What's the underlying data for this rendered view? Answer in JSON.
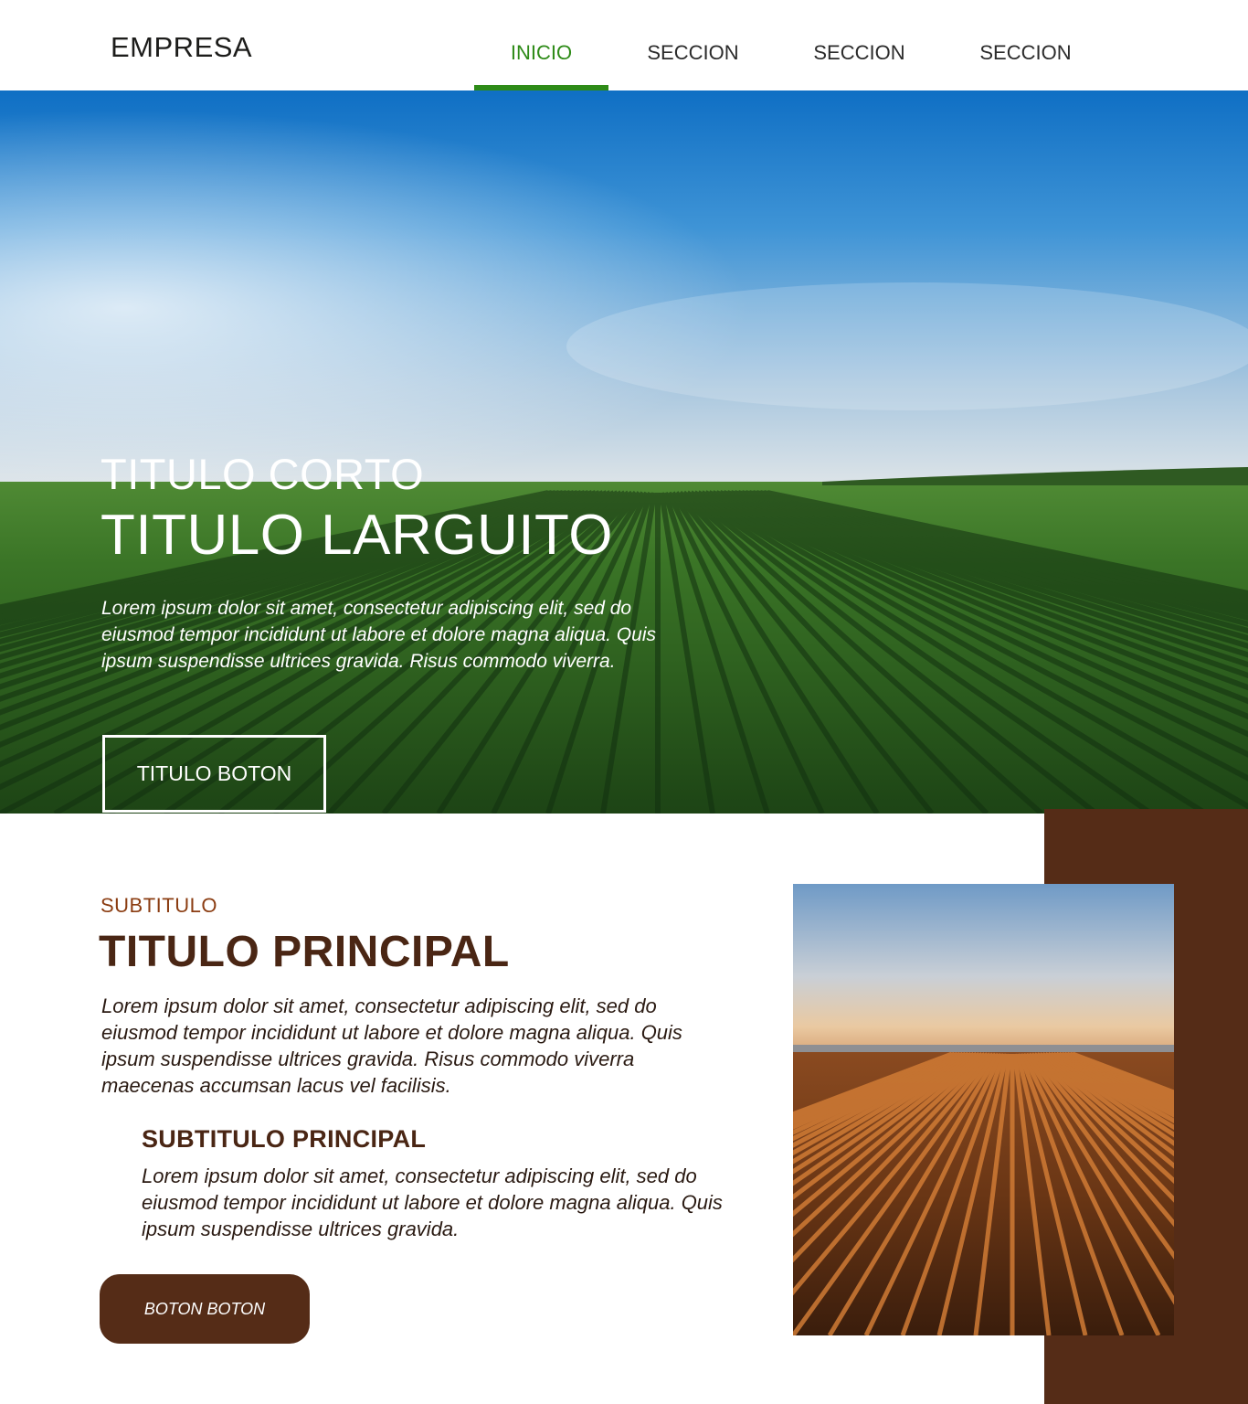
{
  "colors": {
    "accent_green": "#2e8b18",
    "brown_dark": "#552c17",
    "brown_title": "#4a2614",
    "brown_subtitle": "#8b3d12"
  },
  "header": {
    "logo": "EMPRESA",
    "nav": [
      {
        "label": "INICIO",
        "active": true
      },
      {
        "label": "SECCION",
        "active": false
      },
      {
        "label": "SECCION",
        "active": false
      },
      {
        "label": "SECCION",
        "active": false
      }
    ]
  },
  "hero": {
    "image": "green-crop-field-photo",
    "title_short": "TITULO CORTO",
    "title_long": "TITULO LARGUITO",
    "text": "Lorem ipsum dolor sit amet, consectetur adipiscing elit, sed do eiusmod tempor incididunt ut labore et dolore magna aliqua. Quis ipsum suspendisse ultrices gravida. Risus commodo viverra.",
    "button_label": "TITULO BOTON"
  },
  "content": {
    "subtitle": "SUBTITULO",
    "title": "TITULO PRINCIPAL",
    "text": "Lorem ipsum dolor sit amet, consectetur adipiscing elit, sed do eiusmod tempor incididunt ut labore et dolore magna aliqua. Quis ipsum suspendisse ultrices gravida. Risus commodo viverra maecenas accumsan lacus vel facilisis.",
    "sub_heading": "SUBTITULO PRINCIPAL",
    "sub_text": "Lorem ipsum dolor sit amet, consectetur adipiscing elit, sed do eiusmod tempor incididunt ut labore et dolore magna aliqua. Quis ipsum suspendisse ultrices gravida.",
    "button_label": "BOTON BOTON",
    "image": "plowed-field-sunset-photo"
  }
}
